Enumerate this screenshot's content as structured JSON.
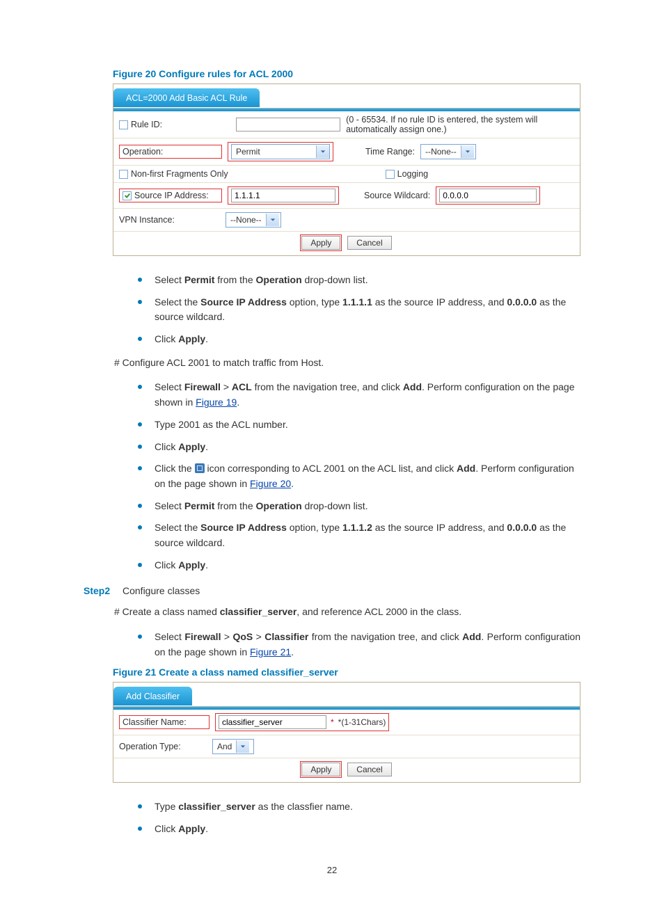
{
  "page_number": "22",
  "figure20": {
    "caption": "Figure 20 Configure rules for ACL 2000",
    "tab_title": "ACL=2000 Add Basic ACL Rule",
    "rule_id_label": "Rule ID:",
    "rule_id_value": "",
    "rule_id_hint": "(0 - 65534. If no rule ID is entered, the system will automatically assign one.)",
    "operation_label": "Operation:",
    "operation_value": "Permit",
    "time_range_label": "Time Range:",
    "time_range_value": "--None--",
    "nonfirst_label": "Non-first Fragments Only",
    "logging_label": "Logging",
    "srcip_label": "Source IP Address:",
    "srcip_value": "1.1.1.1",
    "srcwild_label": "Source Wildcard:",
    "srcwild_value": "0.0.0.0",
    "vpn_label": "VPN Instance:",
    "vpn_value": "--None--",
    "apply": "Apply",
    "cancel": "Cancel"
  },
  "bullets_a": {
    "b1_pre": "Select ",
    "b1_permit": "Permit",
    "b1_mid": " from the ",
    "b1_op": "Operation",
    "b1_post": " drop-down list.",
    "b2_pre": "Select the ",
    "b2_srcip": "Source IP Address",
    "b2_mid": " option, type ",
    "b2_ip": "1.1.1.1",
    "b2_mid2": " as the source IP address, and ",
    "b2_wild": "0.0.0.0",
    "b2_post": " as the source wildcard.",
    "b3_pre": "Click ",
    "b3_apply": "Apply",
    "b3_post": "."
  },
  "hash1": "# Configure ACL 2001 to match traffic from Host.",
  "bullets_b": {
    "b1_pre": "Select ",
    "b1_fw": "Firewall",
    "b1_gt": " > ",
    "b1_acl": "ACL",
    "b1_mid": " from the navigation tree, and click ",
    "b1_add": "Add",
    "b1_post": ". Perform configuration on the page shown in ",
    "b1_link": "Figure 19",
    "b1_dot": ".",
    "b2": "Type 2001 as the ACL number.",
    "b3_pre": "Click ",
    "b3_apply": "Apply",
    "b3_post": ".",
    "b4_pre": "Click the ",
    "b4_mid": " icon corresponding to ACL 2001 on the ACL list, and click ",
    "b4_add": "Add",
    "b4_post": ". Perform configuration on the page shown in ",
    "b4_link": "Figure 20",
    "b4_dot": ".",
    "b5_pre": "Select ",
    "b5_permit": "Permit",
    "b5_mid": " from the ",
    "b5_op": "Operation",
    "b5_post": " drop-down list.",
    "b6_pre": "Select the ",
    "b6_srcip": "Source IP Address",
    "b6_mid": " option, type ",
    "b6_ip": "1.1.1.2",
    "b6_mid2": " as the source IP address, and ",
    "b6_wild": "0.0.0.0",
    "b6_post": " as the source wildcard.",
    "b7_pre": "Click ",
    "b7_apply": "Apply",
    "b7_post": "."
  },
  "step2": {
    "label": "Step2",
    "text": "Configure classes"
  },
  "hash2_pre": "# Create a class named ",
  "hash2_name": "classifier_server",
  "hash2_post": ", and reference ACL 2000 in the class.",
  "bullets_c": {
    "b1_pre": "Select ",
    "b1_fw": "Firewall",
    "b1_gt1": " > ",
    "b1_qos": "QoS",
    "b1_gt2": " > ",
    "b1_cls": "Classifier",
    "b1_mid": " from the navigation tree, and click ",
    "b1_add": "Add",
    "b1_post": ". Perform configuration on the page shown in ",
    "b1_link": "Figure 21",
    "b1_dot": "."
  },
  "figure21": {
    "caption_pre": "Figure 21 Create a class named ",
    "caption_bold": "classifier_server",
    "tab_title": "Add Classifier",
    "name_label": "Classifier Name:",
    "name_value": "classifier_server",
    "name_hint": "*(1-31Chars)",
    "optype_label": "Operation Type:",
    "optype_value": "And",
    "apply": "Apply",
    "cancel": "Cancel"
  },
  "bullets_d": {
    "b1_pre": "Type ",
    "b1_name": "classifier_server",
    "b1_post": " as the classfier name.",
    "b2_pre": "Click ",
    "b2_apply": "Apply",
    "b2_post": "."
  }
}
